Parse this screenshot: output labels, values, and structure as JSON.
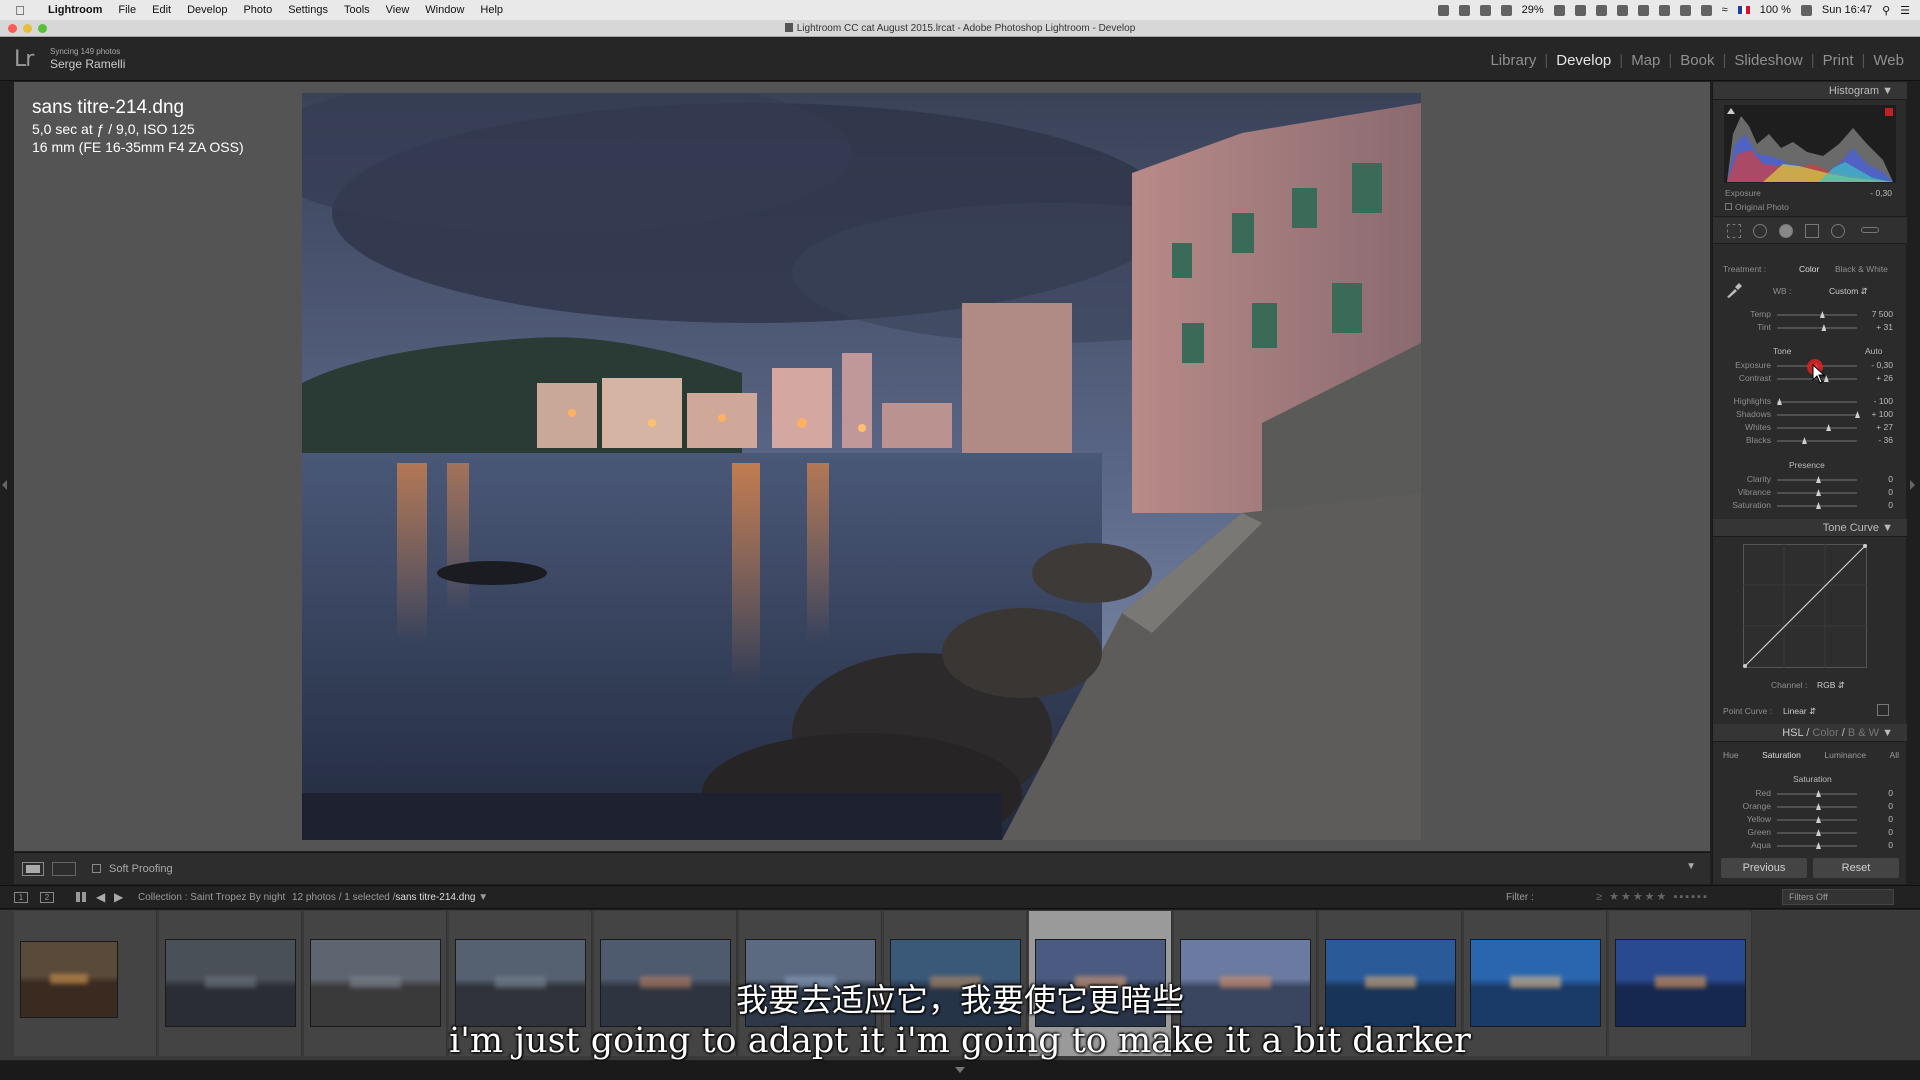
{
  "menubar": {
    "app": "Lightroom",
    "items": [
      "File",
      "Edit",
      "Develop",
      "Photo",
      "Settings",
      "Tools",
      "View",
      "Window",
      "Help"
    ],
    "battery": "29%",
    "battery2": "100 %",
    "clock": "Sun 16:47"
  },
  "window": {
    "title": "Lightroom CC cat August 2015.lrcat - Adobe Photoshop Lightroom - Develop"
  },
  "identity": {
    "logo": "Lr",
    "sync_status": "Syncing 149 photos",
    "user": "Serge Ramelli"
  },
  "modules": [
    "Library",
    "Develop",
    "Map",
    "Book",
    "Slideshow",
    "Print",
    "Web"
  ],
  "active_module": "Develop",
  "photo_info": {
    "filename": "sans titre-214.dng",
    "exposure_line": "5,0 sec at ƒ / 9,0, ISO 125",
    "lens_line": "16 mm (FE 16-35mm F4 ZA OSS)"
  },
  "toolbar": {
    "soft_proofing": "Soft Proofing"
  },
  "right_panel": {
    "histogram_title": "Histogram",
    "exposure_label": "Exposure",
    "exposure_readout": "- 0,30",
    "original_photo": "Original Photo",
    "treatment_label": "Treatment :",
    "treatment_color": "Color",
    "treatment_bw": "Black & White",
    "wb_label": "WB :",
    "wb_value": "Custom",
    "tone_label": "Tone",
    "auto_label": "Auto",
    "presence_label": "Presence",
    "basic_sliders": [
      {
        "name": "Temp",
        "value": "7 500",
        "pos": 0.55
      },
      {
        "name": "Tint",
        "value": "+ 31",
        "pos": 0.57
      }
    ],
    "tone_sliders": [
      {
        "name": "Exposure",
        "value": "- 0,30",
        "pos": 0.47
      },
      {
        "name": "Contrast",
        "value": "+ 26",
        "pos": 0.6
      }
    ],
    "tone_sliders2": [
      {
        "name": "Highlights",
        "value": "- 100",
        "pos": 0.0
      },
      {
        "name": "Shadows",
        "value": "+ 100",
        "pos": 1.0
      },
      {
        "name": "Whites",
        "value": "+ 27",
        "pos": 0.63
      },
      {
        "name": "Blacks",
        "value": "- 36",
        "pos": 0.32
      }
    ],
    "presence_sliders": [
      {
        "name": "Clarity",
        "value": "0",
        "pos": 0.5
      },
      {
        "name": "Vibrance",
        "value": "0",
        "pos": 0.5
      },
      {
        "name": "Saturation",
        "value": "0",
        "pos": 0.5
      }
    ],
    "tone_curve_title": "Tone Curve",
    "channel_label": "Channel :",
    "channel_value": "RGB",
    "point_curve_label": "Point Curve :",
    "point_curve_value": "Linear",
    "hsl_title": "HSL",
    "hsl_color": "Color",
    "hsl_bw": "B & W",
    "hsl_tabs": [
      "Hue",
      "Saturation",
      "Luminance",
      "All"
    ],
    "hsl_active": "Saturation",
    "hsl_section": "Saturation",
    "hsl_sliders": [
      {
        "name": "Red",
        "value": "0"
      },
      {
        "name": "Orange",
        "value": "0"
      },
      {
        "name": "Yellow",
        "value": "0"
      },
      {
        "name": "Green",
        "value": "0"
      },
      {
        "name": "Aqua",
        "value": "0"
      }
    ],
    "previous_button": "Previous",
    "reset_button": "Reset"
  },
  "filmstrip_nav": {
    "page1": "1",
    "page2": "2",
    "collection": "Collection : Saint Tropez By night",
    "count": "12 photos / 1 selected /",
    "current_file": "sans titre-214.dng",
    "filter_label": "Filter :",
    "filters_off": "Filters Off"
  },
  "filmstrip": {
    "selected_index": 7,
    "thumbs": [
      {
        "sky": "#5a4a3a",
        "ground": "#3a2a20",
        "light": "#e0a050"
      },
      {
        "sky": "#4a5058",
        "ground": "#2a2e34",
        "light": "#707880"
      },
      {
        "sky": "#5e6470",
        "ground": "#3a3a3a",
        "light": "#808890"
      },
      {
        "sky": "#556070",
        "ground": "#30343a",
        "light": "#7a8898"
      },
      {
        "sky": "#4e5a6e",
        "ground": "#2f3540",
        "light": "#c08060"
      },
      {
        "sky": "#5b6a80",
        "ground": "#2e3848",
        "light": "#8aa0c0"
      },
      {
        "sky": "#3a5878",
        "ground": "#263448",
        "light": "#c09060"
      },
      {
        "sky": "#4a5a80",
        "ground": "#2a3448",
        "light": "#e0a070"
      },
      {
        "sky": "#6a7aa0",
        "ground": "#3a4660",
        "light": "#e09060"
      },
      {
        "sky": "#2a5a98",
        "ground": "#183458",
        "light": "#e8b070"
      },
      {
        "sky": "#2a66b0",
        "ground": "#1a3a68",
        "light": "#f0c080"
      },
      {
        "sky": "#2a4a90",
        "ground": "#162850",
        "light": "#f0a050"
      }
    ]
  },
  "subtitles": {
    "zh": "我要去适应它，我要使它更暗些",
    "en": "i'm just going to adapt it i'm going to make it a bit darker"
  }
}
